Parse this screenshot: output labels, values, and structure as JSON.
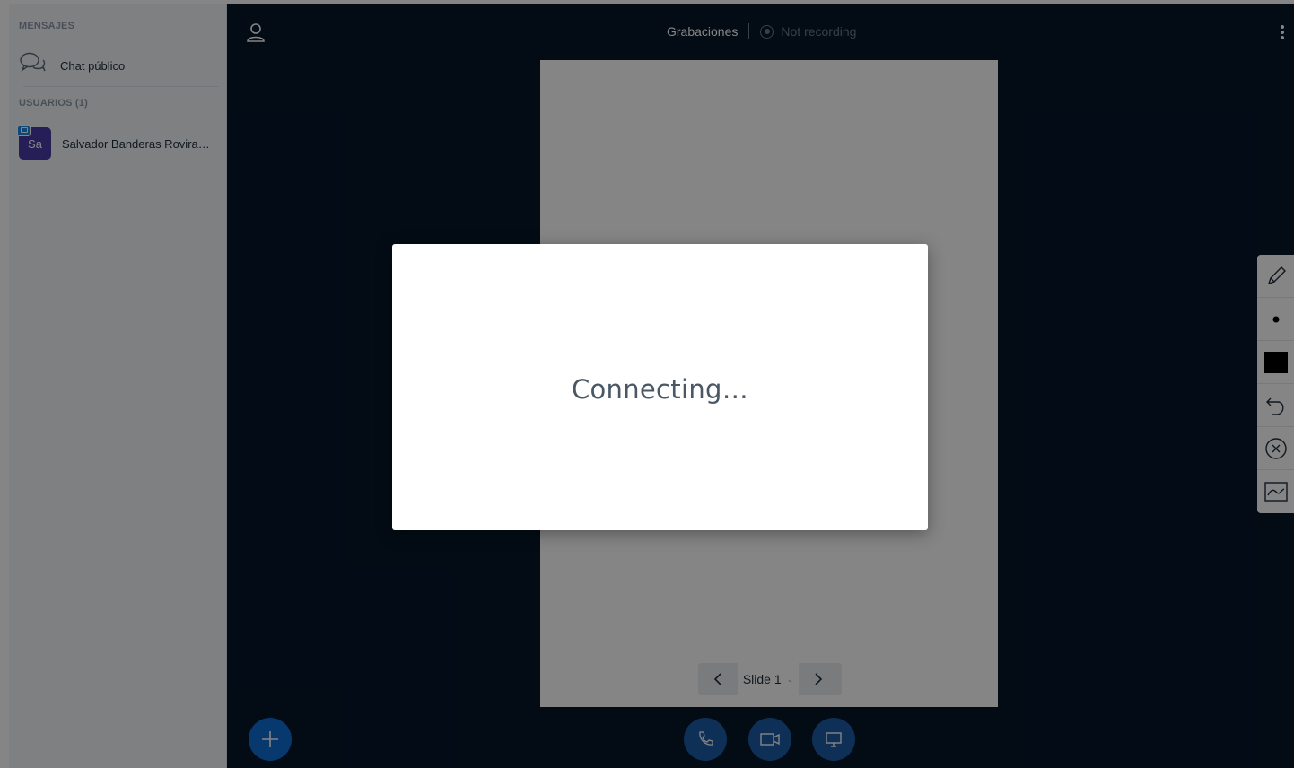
{
  "sidebar": {
    "messages_title": "MENSAJES",
    "public_chat_label": "Chat público",
    "users_title": "USUARIOS (1)",
    "users": [
      {
        "initials": "Sa",
        "name": "Salvador Banderas Rovira…",
        "avatar_color": "#4a3aa8"
      }
    ]
  },
  "topbar": {
    "recordings_label": "Grabaciones",
    "recording_status": "Not recording"
  },
  "presentation": {
    "slide_label": "Slide 1"
  },
  "annotation_tools": [
    {
      "name": "pencil-icon"
    },
    {
      "name": "dot-icon"
    },
    {
      "name": "color-swatch-icon",
      "color": "#000000"
    },
    {
      "name": "undo-icon"
    },
    {
      "name": "clear-icon"
    },
    {
      "name": "whiteboard-mode-icon"
    }
  ],
  "actions": {
    "add": "add-icon",
    "audio": "phone-icon",
    "video": "video-icon",
    "screenshare": "screen-icon"
  },
  "modal": {
    "message": "Connecting…"
  },
  "colors": {
    "main_bg": "#06172a",
    "sidebar_bg": "#f3f6f9",
    "accent": "#0f6ed4"
  }
}
